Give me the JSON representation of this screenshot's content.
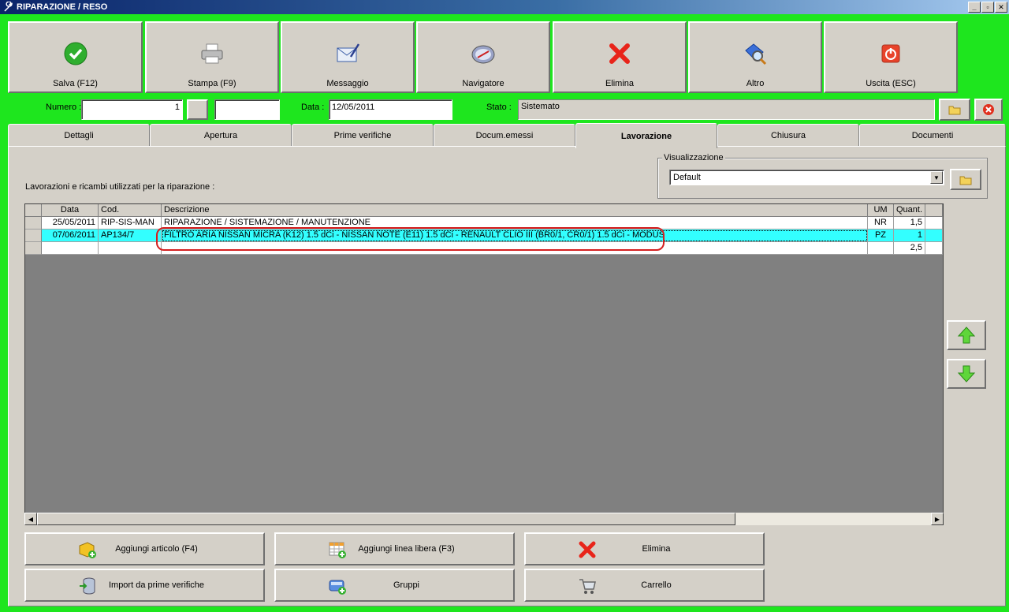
{
  "window": {
    "title": "RIPARAZIONE / RESO"
  },
  "toolbar": [
    {
      "label": "Salva (F12)",
      "icon": "check-icon"
    },
    {
      "label": "Stampa (F9)",
      "icon": "printer-icon"
    },
    {
      "label": "Messaggio",
      "icon": "envelope-icon"
    },
    {
      "label": "Navigatore",
      "icon": "compass-icon"
    },
    {
      "label": "Elimina",
      "icon": "delete-x-icon"
    },
    {
      "label": "Altro",
      "icon": "magnifier-icon"
    },
    {
      "label": "Uscita (ESC)",
      "icon": "power-icon"
    }
  ],
  "header": {
    "numero_label": "Numero",
    "numero_value": "1",
    "numero_suffix": "",
    "data_label": "Data",
    "data_value": "12/05/2011",
    "stato_label": "Stato",
    "stato_value": "Sistemato"
  },
  "tabs": [
    {
      "label": "Dettagli"
    },
    {
      "label": "Apertura"
    },
    {
      "label": "Prime verifiche"
    },
    {
      "label": "Docum.emessi"
    },
    {
      "label": "Lavorazione",
      "active": true
    },
    {
      "label": "Chiusura"
    },
    {
      "label": "Documenti"
    }
  ],
  "lavorazione": {
    "section_label": "Lavorazioni e ricambi utilizzati per la riparazione :",
    "visualizzazione_label": "Visualizzazione",
    "visualizzazione_value": "Default",
    "columns": [
      "Data",
      "Cod.",
      "Descrizione",
      "UM",
      "Quant."
    ],
    "rows": [
      {
        "data": "25/05/2011",
        "cod": "RIP-SIS-MAN",
        "descrizione": "RIPARAZIONE / SISTEMAZIONE / MANUTENZIONE",
        "um": "NR",
        "quant": "1,5",
        "selected": false
      },
      {
        "data": "07/06/2011",
        "cod": "AP134/7",
        "descrizione": "FILTRO ARIA NISSAN MICRA (K12) 1.5 dCi - NISSAN NOTE (E11) 1.5 dCi - RENAULT CLIO III (BR0/1, CR0/1) 1.5 dCi - MODUS",
        "um": "PZ",
        "quant": "1",
        "selected": true
      },
      {
        "data": "",
        "cod": "",
        "descrizione": "",
        "um": "",
        "quant": "2,5",
        "selected": false
      }
    ]
  },
  "actions": [
    {
      "label": "Aggiungi articolo (F4)",
      "icon": "add-box-icon"
    },
    {
      "label": "Aggiungi linea libera (F3)",
      "icon": "add-grid-icon"
    },
    {
      "label": "Elimina",
      "icon": "delete-x-icon"
    },
    {
      "label": "Import da prime verifiche",
      "icon": "import-db-icon"
    },
    {
      "label": "Gruppi",
      "icon": "group-add-icon"
    },
    {
      "label": "Carrello",
      "icon": "cart-icon"
    }
  ],
  "colors": {
    "frame": "#1ee61e",
    "selection": "#33ffff",
    "accent_red": "#d42020"
  }
}
